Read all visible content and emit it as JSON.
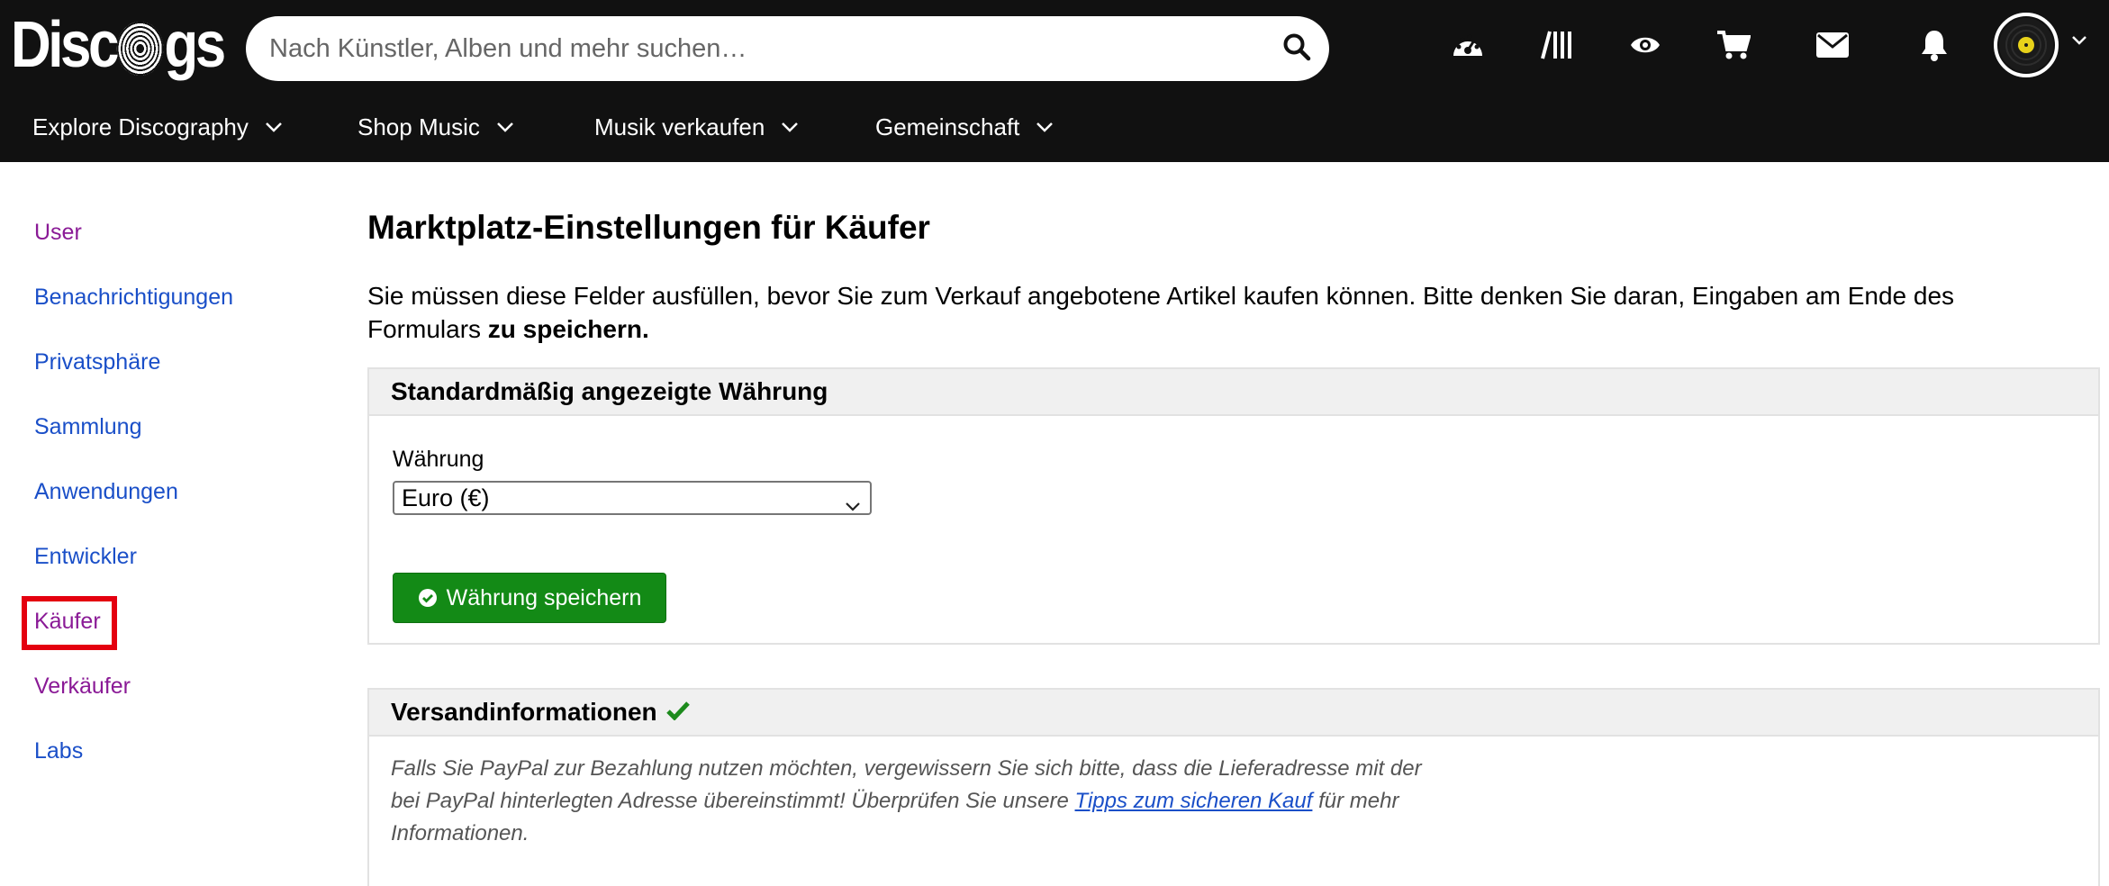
{
  "header": {
    "logo_text": "Discogs",
    "search_placeholder": "Nach Künstler, Alben und mehr suchen…",
    "icons": [
      "dashboard-icon",
      "collection-icon",
      "wantlist-icon",
      "cart-icon",
      "messages-icon",
      "notifications-icon"
    ],
    "nav": [
      {
        "label": "Explore Discography"
      },
      {
        "label": "Shop Music"
      },
      {
        "label": "Musik verkaufen"
      },
      {
        "label": "Gemeinschaft"
      }
    ]
  },
  "sidebar": {
    "items": [
      {
        "label": "User",
        "state": "visited"
      },
      {
        "label": "Benachrichtigungen",
        "state": "link"
      },
      {
        "label": "Privatsphäre",
        "state": "link"
      },
      {
        "label": "Sammlung",
        "state": "link"
      },
      {
        "label": "Anwendungen",
        "state": "link"
      },
      {
        "label": "Entwickler",
        "state": "link"
      },
      {
        "label": "Käufer",
        "state": "active"
      },
      {
        "label": "Verkäufer",
        "state": "visited"
      },
      {
        "label": "Labs",
        "state": "link"
      }
    ]
  },
  "main": {
    "title": "Marktplatz-Einstellungen für Käufer",
    "intro_text": "Sie müssen diese Felder ausfüllen, bevor Sie zum Verkauf angebotene Artikel kaufen können. Bitte denken Sie daran, Eingaben am Ende des Formulars ",
    "intro_bold": "zu speichern.",
    "currency_panel": {
      "heading": "Standardmäßig angezeigte Währung",
      "field_label": "Währung",
      "selected": "Euro (€)",
      "save_label": "Währung speichern"
    },
    "shipping_panel": {
      "heading": "Versandinformationen",
      "text_before": "Falls Sie PayPal zur Bezahlung nutzen möchten, vergewissern Sie sich bitte, dass die Lieferadresse mit der bei PayPal hinterlegten Adresse übereinstimmt! Überprüfen Sie unsere ",
      "link": "Tipps zum sicheren Kauf",
      "text_after": " für mehr Informationen."
    }
  },
  "colors": {
    "header_bg": "#111111",
    "visited_link": "#8a1a96",
    "link": "#1a4fc8",
    "active_highlight": "#e4000f",
    "save_button": "#138a16",
    "check": "#1c8a1c"
  }
}
